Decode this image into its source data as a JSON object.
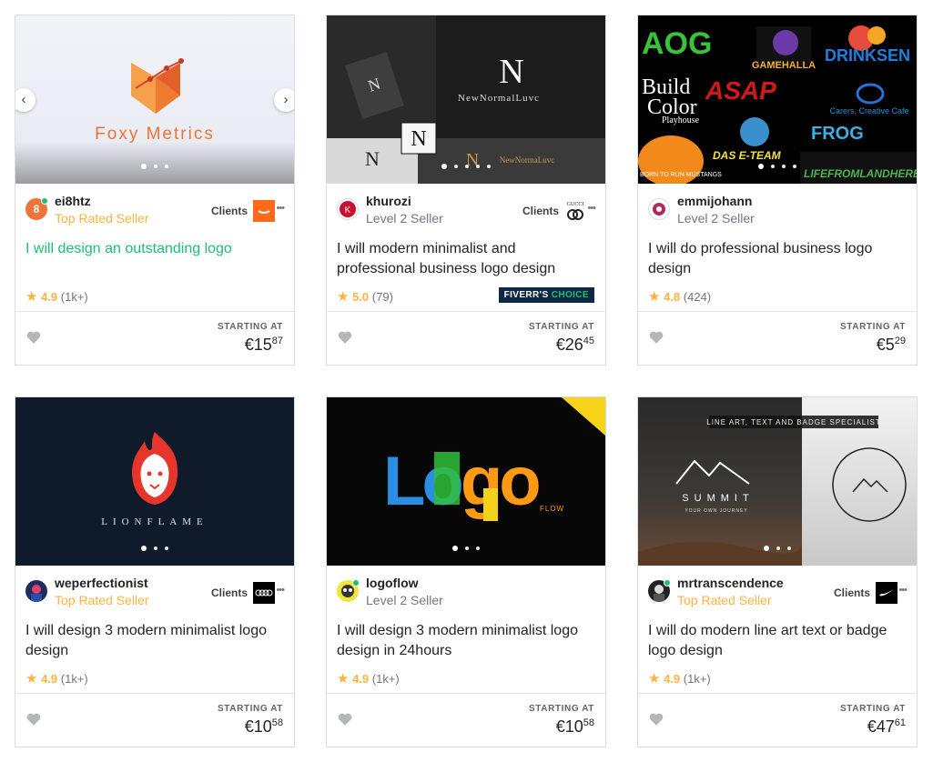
{
  "gigs": [
    {
      "seller": "ei8htz",
      "level": "Top Rated Seller",
      "title": "I will design an outstanding logo",
      "rating": "4.9",
      "reviews": "(1k+)",
      "starting": "STARTING AT",
      "price_main": "€15",
      "price_cents": "87",
      "clients": "Clients",
      "image_text": {
        "brand": "Foxy Metrics"
      }
    },
    {
      "seller": "khurozi",
      "level": "Level 2 Seller",
      "title": "I will modern minimalist and professional business logo design",
      "rating": "5.0",
      "reviews": "(79)",
      "badge_main": "FIVERR'S",
      "badge_accent": "CHOICE",
      "starting": "STARTING AT",
      "price_main": "€26",
      "price_cents": "45",
      "clients": "Clients",
      "client_logo_text": "GUCCI",
      "image_text": {
        "brand": "NewNormalLuvc"
      }
    },
    {
      "seller": "emmijohann",
      "level": "Level 2 Seller",
      "title": "I will do professional business logo design",
      "rating": "4.8",
      "reviews": "(424)",
      "starting": "STARTING AT",
      "price_main": "€5",
      "price_cents": "29",
      "image_text": {
        "l1": "AOG",
        "l2": "GAMEHALLA",
        "l3": "DRINKSEN",
        "l4": "Build",
        "l5": "Color",
        "l6": "Playhouse",
        "l7": "ASAP",
        "l8": "Carers, Creative Cafe",
        "l9": "FROG",
        "l10": "DAS E-TEAM",
        "l11": "BORN TO RUN MUSTANGS",
        "l12": "LIFEFROMLANDHERBS"
      }
    },
    {
      "seller": "weperfectionist",
      "level": "Top Rated Seller",
      "title": "I will design 3 modern minimalist logo design",
      "rating": "4.9",
      "reviews": "(1k+)",
      "starting": "STARTING AT",
      "price_main": "€10",
      "price_cents": "58",
      "clients": "Clients",
      "image_text": {
        "brand": "LIONFLAME"
      }
    },
    {
      "seller": "logoflow",
      "level": "Level 2 Seller",
      "title": "I will design 3 modern minimalist logo design in 24hours",
      "rating": "4.9",
      "reviews": "(1k+)",
      "starting": "STARTING AT",
      "price_main": "€10",
      "price_cents": "58",
      "image_text": {
        "l1": "Lo",
        "l2": "go",
        "l3": "FLOW"
      }
    },
    {
      "seller": "mrtranscendence",
      "level": "Top Rated Seller",
      "title": "I will do modern line art text or badge logo design",
      "rating": "4.9",
      "reviews": "(1k+)",
      "starting": "STARTING AT",
      "price_main": "€47",
      "price_cents": "61",
      "clients": "Clients",
      "image_text": {
        "banner": "LINE ART, TEXT AND BADGE SPECIALIST",
        "brand": "SUMMIT",
        "tagline": "YOUR OWN JOURNEY"
      }
    }
  ],
  "colors": {
    "top_rated": "#ffb33e",
    "level": "#74767e",
    "accent_green": "#1dbf73",
    "star": "#ffb33e"
  }
}
